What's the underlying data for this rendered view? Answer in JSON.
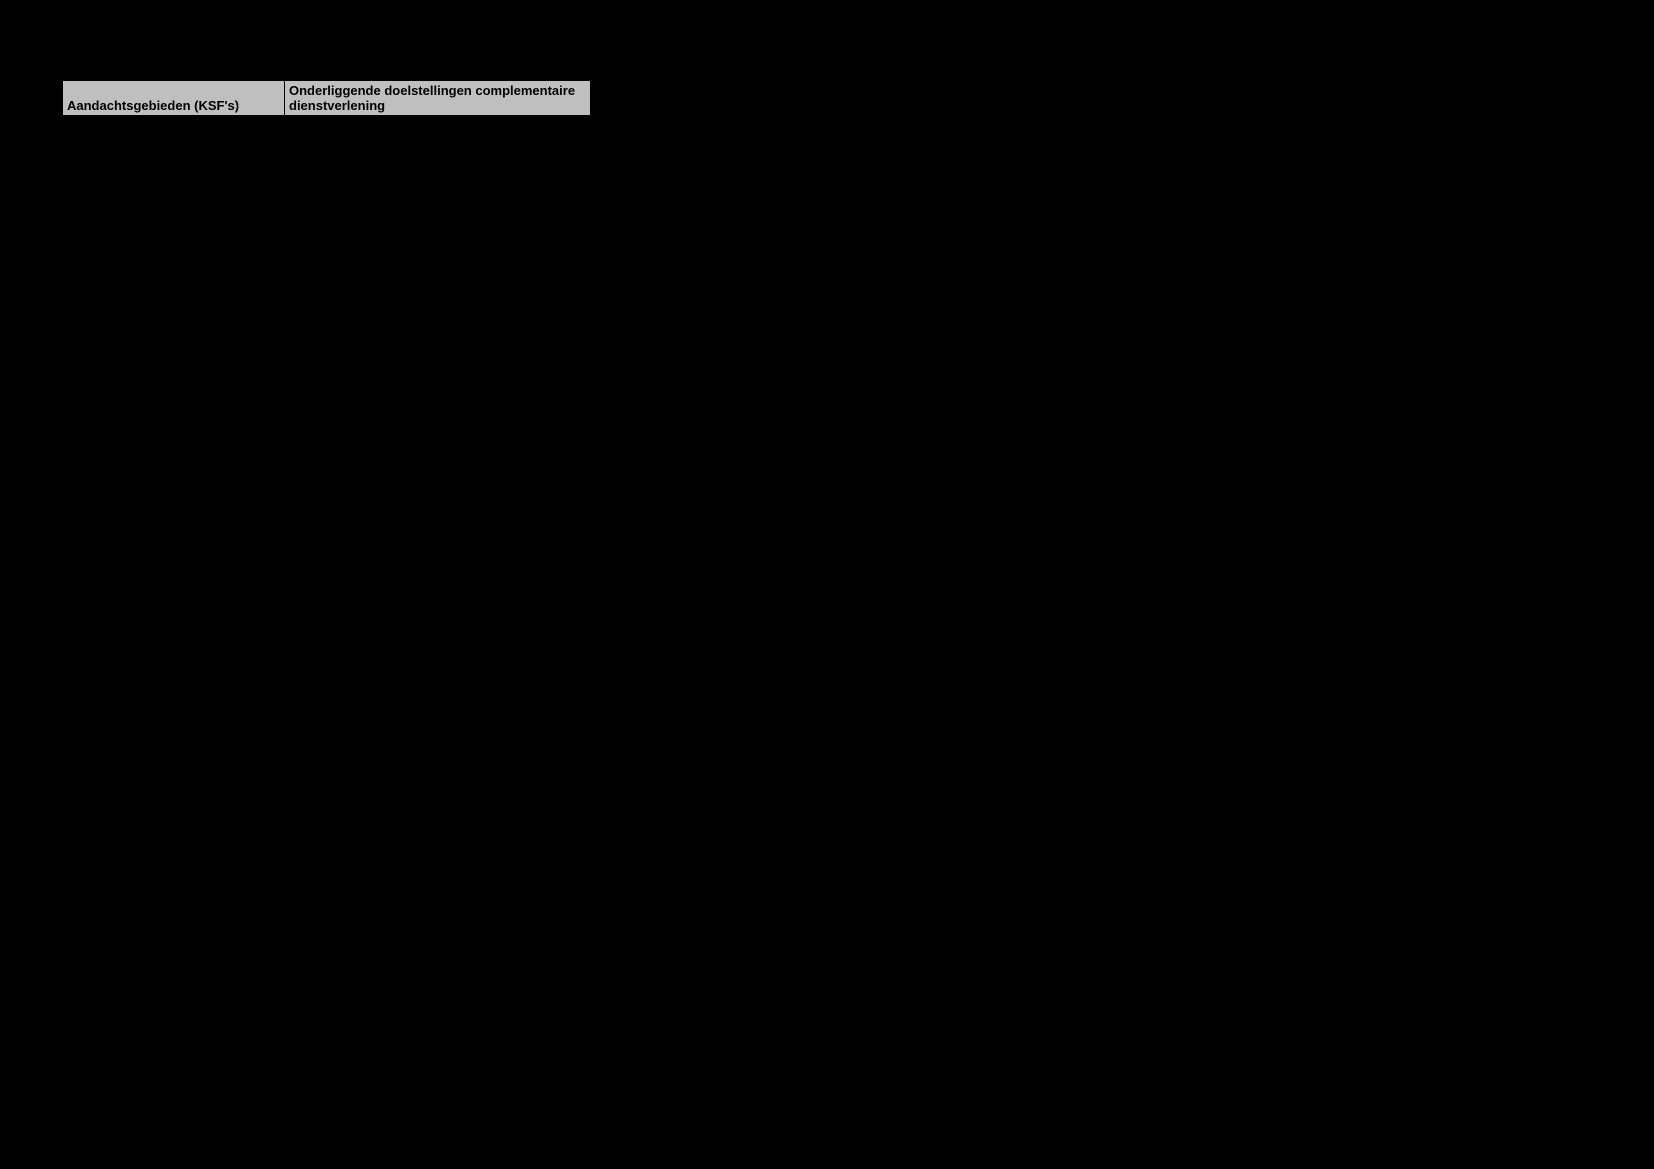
{
  "table": {
    "headers": {
      "col1": "Aandachtsgebieden (KSF's)",
      "col2": "Onderliggende doelstellingen complementaire dienstverlening"
    }
  }
}
